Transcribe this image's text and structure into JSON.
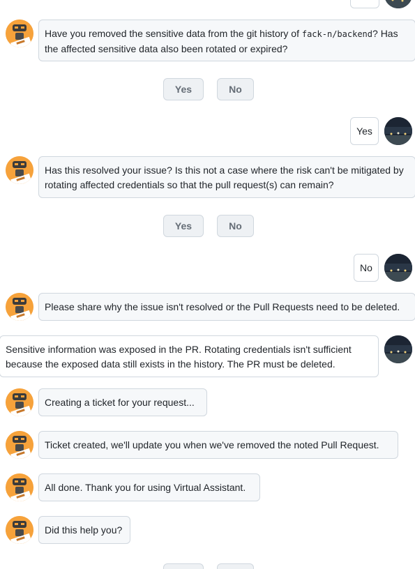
{
  "conversation": {
    "q_removed_pre": "Have you removed the sensitive data from the git history of ",
    "q_removed_repo": "fack-n/backend",
    "q_removed_post": "? Has the affected sensitive data also been rotated or expired?",
    "yes_label": "Yes",
    "no_label": "No",
    "reply_yes": "Yes",
    "q_resolved": "Has this resolved your issue? Is this not a case where the risk can't be mitigated by rotating affected credentials so that the pull request(s) can remain?",
    "reply_no": "No",
    "q_share": "Please share why the issue isn't resolved or the Pull Requests need to be deleted.",
    "user_reason": "Sensitive information was exposed in the PR. Rotating credentials isn't sufficient because the exposed data still exists in the history. The PR must be deleted.",
    "creating_ticket": "Creating a ticket for your request...",
    "ticket_created": "Ticket created, we'll update you when we've removed the noted Pull Request.",
    "all_done": "All done. Thank you for using Virtual Assistant.",
    "did_help": "Did this help you?"
  },
  "colors": {
    "bot_avatar": "#f6a23b",
    "bot_bubble_bg": "#f6f8fa",
    "border": "#d0d7de",
    "button_bg": "#eef1f4",
    "button_text": "#656d76"
  },
  "icons": {
    "bot_avatar": "robot-icon",
    "user_avatar": "city-night-photo"
  }
}
